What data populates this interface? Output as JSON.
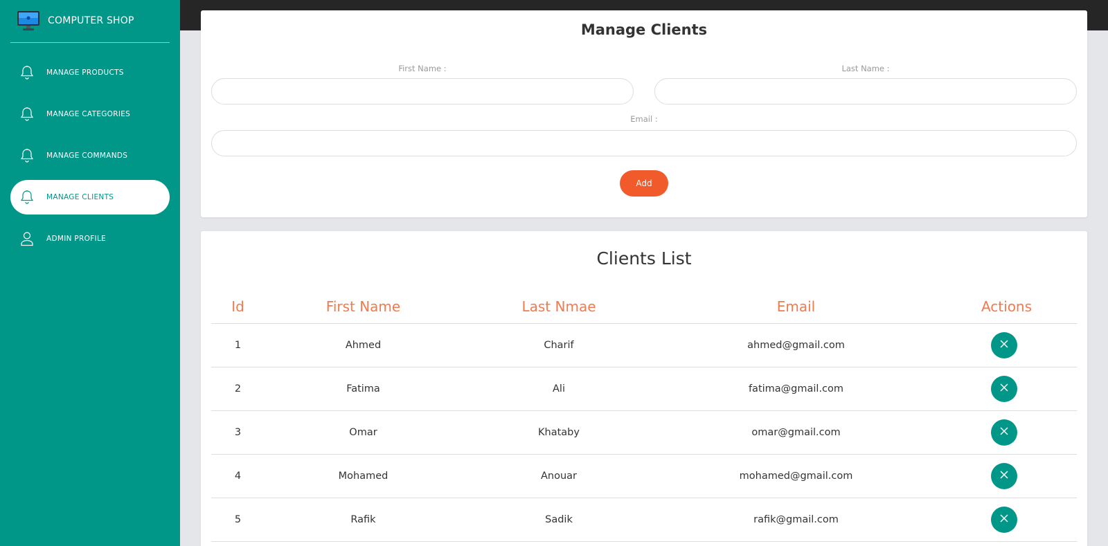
{
  "brand": {
    "title": "COMPUTER SHOP",
    "logo_icon": "monitor-icon"
  },
  "sidebar": {
    "items": [
      {
        "label": "MANAGE PRODUCTS",
        "icon": "bell-icon",
        "active": false
      },
      {
        "label": "MANAGE CATEGORIES",
        "icon": "bell-icon",
        "active": false
      },
      {
        "label": "MANAGE COMMANDS",
        "icon": "bell-icon",
        "active": false
      },
      {
        "label": "MANAGE CLIENTS",
        "icon": "bell-icon",
        "active": true
      },
      {
        "label": "ADMIN PROFILE",
        "icon": "user-icon",
        "active": false
      }
    ]
  },
  "form": {
    "title": "Manage Clients",
    "first_name_label": "First Name :",
    "first_name_value": "",
    "last_name_label": "Last Name :",
    "last_name_value": "",
    "email_label": "Email :",
    "email_value": "",
    "add_label": "Add"
  },
  "list": {
    "title": "Clients List",
    "columns": [
      "Id",
      "First Name",
      "Last Nmae",
      "Email",
      "Actions"
    ],
    "rows": [
      {
        "id": "1",
        "first": "Ahmed",
        "last": "Charif",
        "email": "ahmed@gmail.com"
      },
      {
        "id": "2",
        "first": "Fatima",
        "last": "Ali",
        "email": "fatima@gmail.com"
      },
      {
        "id": "3",
        "first": "Omar",
        "last": "Khataby",
        "email": "omar@gmail.com"
      },
      {
        "id": "4",
        "first": "Mohamed",
        "last": "Anouar",
        "email": "mohamed@gmail.com"
      },
      {
        "id": "5",
        "first": "Rafik",
        "last": "Sadik",
        "email": "rafik@gmail.com"
      }
    ]
  },
  "colors": {
    "primary": "#009688",
    "accent": "#f15a2b",
    "header_text": "#f27a4c",
    "topbar": "#262626"
  }
}
